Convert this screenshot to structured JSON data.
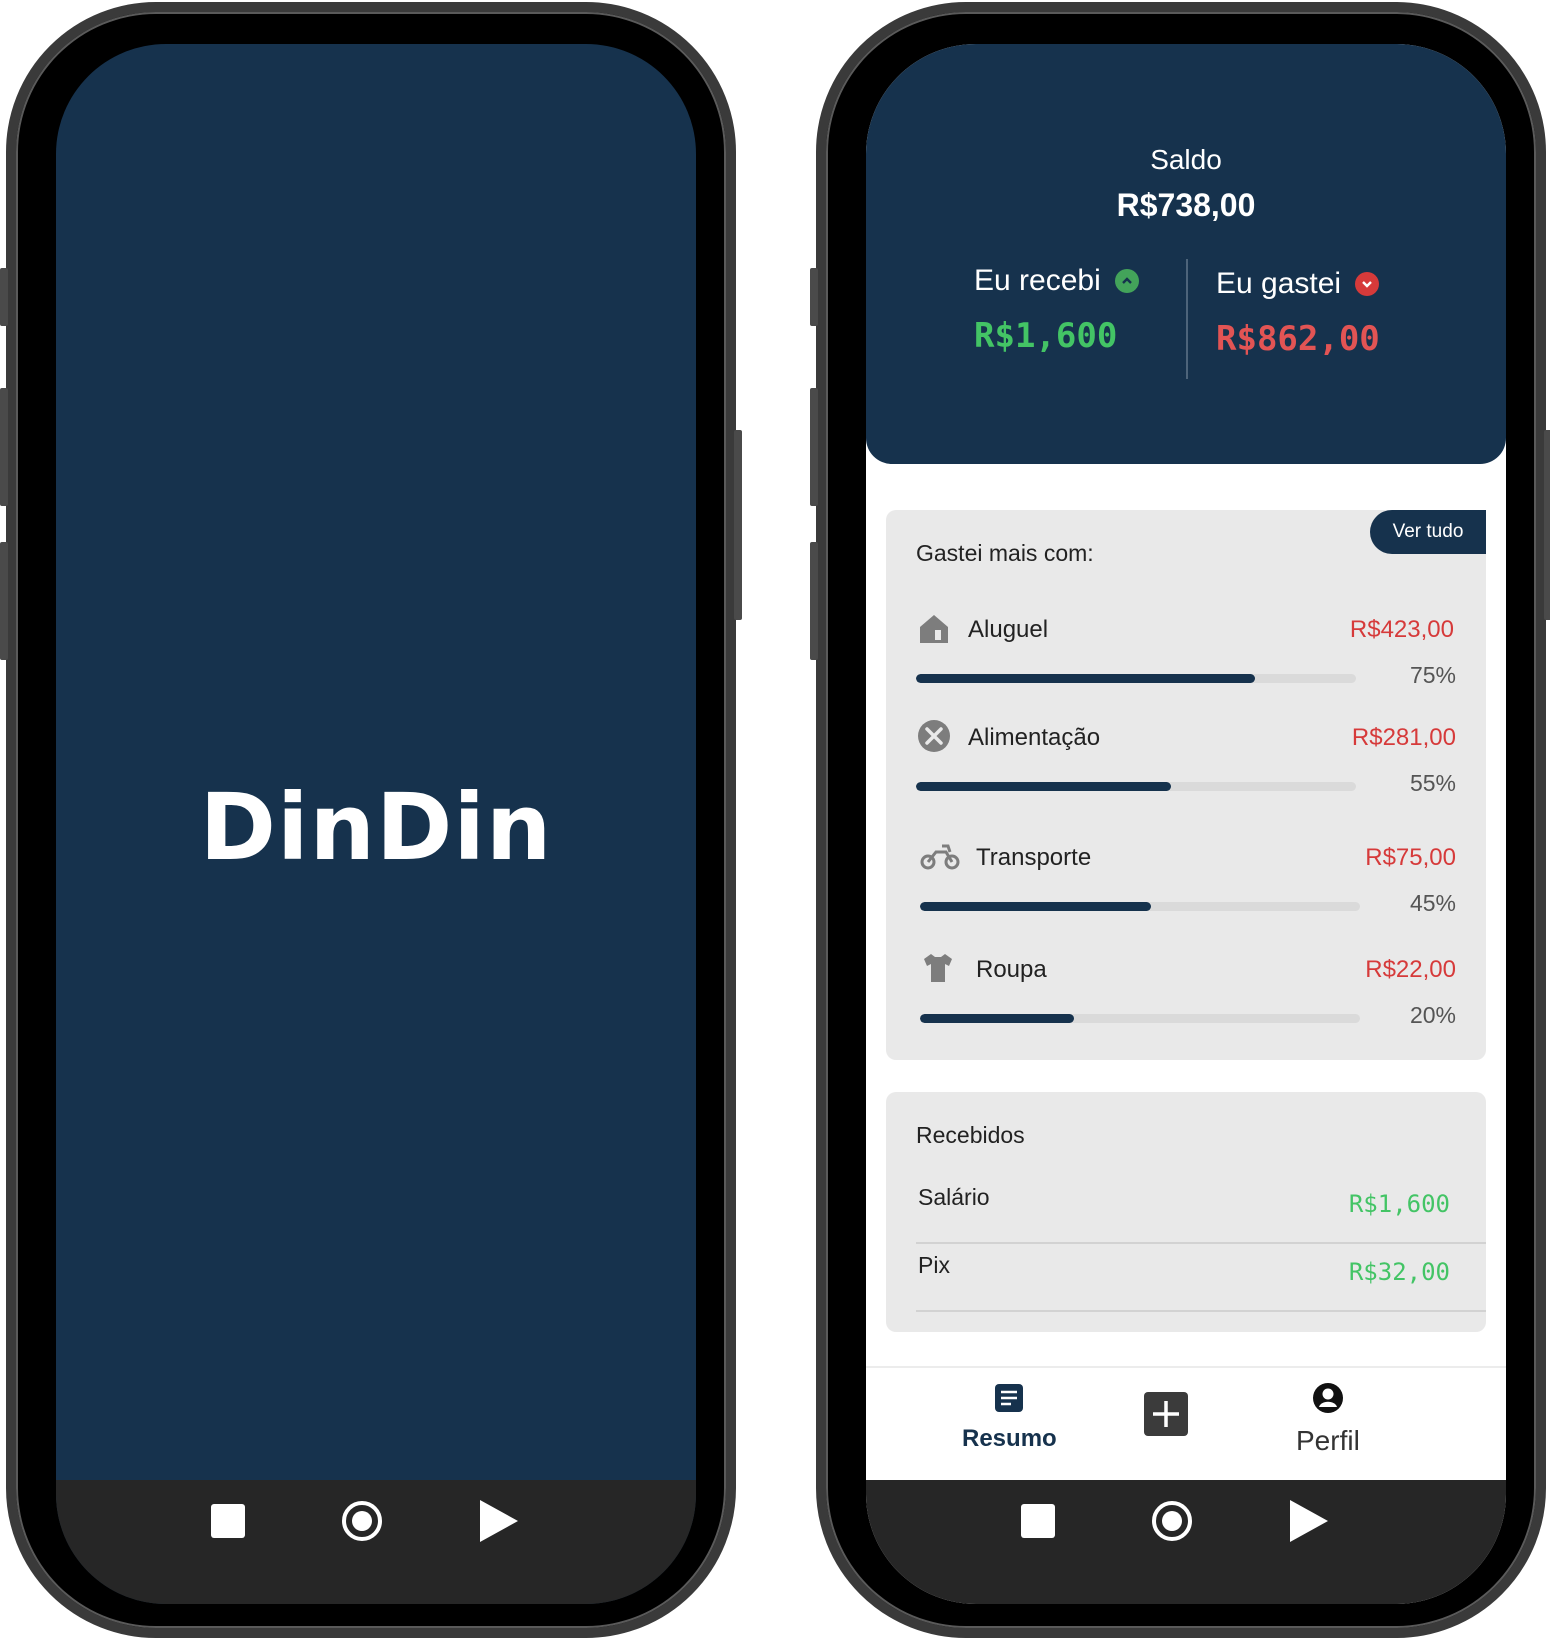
{
  "splash": {
    "title": "DinDin"
  },
  "summary": {
    "balance_label": "Saldo",
    "balance_value": "R$738,00",
    "received_label": "Eu recebi",
    "received_value": "R$1,600",
    "spent_label": "Eu gastei",
    "spent_value": "R$862,00",
    "received_icon": "chevron-up-circle-icon",
    "spent_icon": "chevron-down-circle-icon"
  },
  "spending": {
    "title": "Gastei mais com:",
    "view_all": "Ver tudo",
    "items": [
      {
        "icon": "house-icon",
        "name": "Aluguel",
        "amount": "R$423,00",
        "percent": "75%",
        "fill": 0.77
      },
      {
        "icon": "cutlery-icon",
        "name": "Alimentação",
        "amount": "R$281,00",
        "percent": "55%",
        "fill": 0.58
      },
      {
        "icon": "motorcycle-icon",
        "name": "Transporte",
        "amount": "R$75,00",
        "percent": "45%",
        "fill": 0.525
      },
      {
        "icon": "tshirt-icon",
        "name": "Roupa",
        "amount": "R$22,00",
        "percent": "20%",
        "fill": 0.35
      }
    ]
  },
  "received": {
    "title": "Recebidos",
    "items": [
      {
        "name": "Salário",
        "amount": "R$1,600"
      },
      {
        "name": "Pix",
        "amount": "R$32,00"
      }
    ]
  },
  "tabs": {
    "summary_label": "Resumo",
    "add_icon": "plus-icon",
    "profile_label": "Perfil"
  },
  "colors": {
    "primary": "#16324d",
    "income": "#43c465",
    "expense": "#d63a3a",
    "card": "#e9e9e9"
  },
  "system_nav": [
    "square-icon",
    "circle-icon",
    "triangle-play-icon"
  ]
}
